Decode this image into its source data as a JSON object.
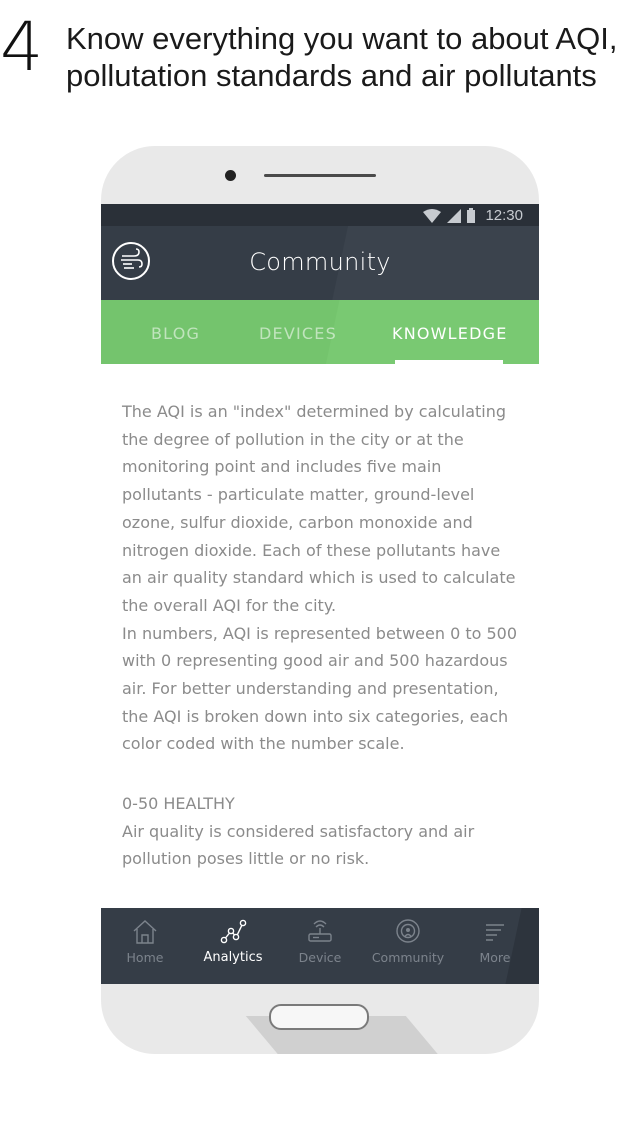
{
  "caption": {
    "step_number": "4",
    "line1": "Know everything you want to about AQI,",
    "line2": "pollutation standards and air pollutants"
  },
  "status_bar": {
    "time": "12:30",
    "icons": [
      "wifi-icon",
      "signal-icon",
      "battery-icon"
    ]
  },
  "app_bar": {
    "title": "Community",
    "logo_icon": "wind-logo-icon"
  },
  "tabs": [
    {
      "label": "BLOG",
      "active": false
    },
    {
      "label": "DEVICES",
      "active": false
    },
    {
      "label": "KNOWLEDGE",
      "active": true
    }
  ],
  "article": {
    "lines": [
      "The AQI is an \"index\" determined by calculating",
      "the degree of pollution in the city or at the",
      "monitoring point and includes five main",
      "pollutants - particulate matter, ground-level",
      "ozone, sulfur dioxide, carbon monoxide and",
      "nitrogen dioxide. Each of these pollutants have",
      "an air quality standard which is used to calculate",
      "the overall AQI for the city.",
      "In numbers, AQI is represented between 0 to 500",
      "with 0 representing good air and 500 hazardous",
      "air. For better understanding and presentation,",
      "the AQI is broken down into six categories, each",
      "color coded with the number scale."
    ]
  },
  "category": {
    "heading": "0-50  HEALTHY",
    "lines": [
      "Air quality is considered satisfactory and air",
      "pollution poses little or no risk."
    ]
  },
  "bottom_nav": [
    {
      "label": "Home",
      "icon": "home-icon",
      "active": false
    },
    {
      "label": "Analytics",
      "icon": "analytics-icon",
      "active": true
    },
    {
      "label": "Device",
      "icon": "router-icon",
      "active": false
    },
    {
      "label": "Community",
      "icon": "community-icon",
      "active": false
    },
    {
      "label": "More",
      "icon": "menu-icon",
      "active": false
    }
  ],
  "colors": {
    "app_bar": "#353d47",
    "tab_bar": "#74c46d",
    "body_text": "#8b8b8b",
    "phone_frame": "#e9e9e9"
  }
}
